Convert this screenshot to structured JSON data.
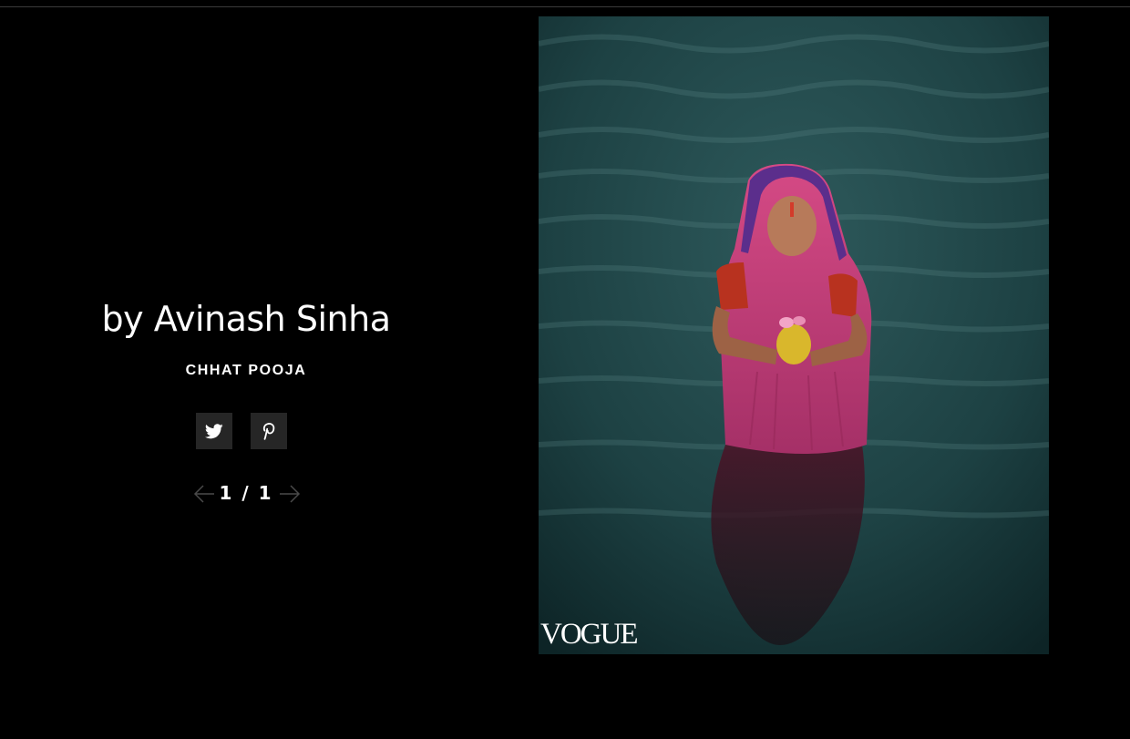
{
  "gallery": {
    "credit": "by Avinash Sinha",
    "caption": "CHHAT POOJA",
    "share": {
      "twitter_icon": "twitter-icon",
      "pinterest_icon": "pinterest-icon"
    },
    "pager": {
      "prev_icon": "arrow-left-icon",
      "count": "1 / 1",
      "next_icon": "arrow-right-icon"
    }
  },
  "photo": {
    "watermark": "VOGUE"
  },
  "colors": {
    "background": "#000000",
    "share_button": "#262626",
    "text": "#ffffff",
    "water": "#1f4446",
    "saree": "#c8447a"
  }
}
